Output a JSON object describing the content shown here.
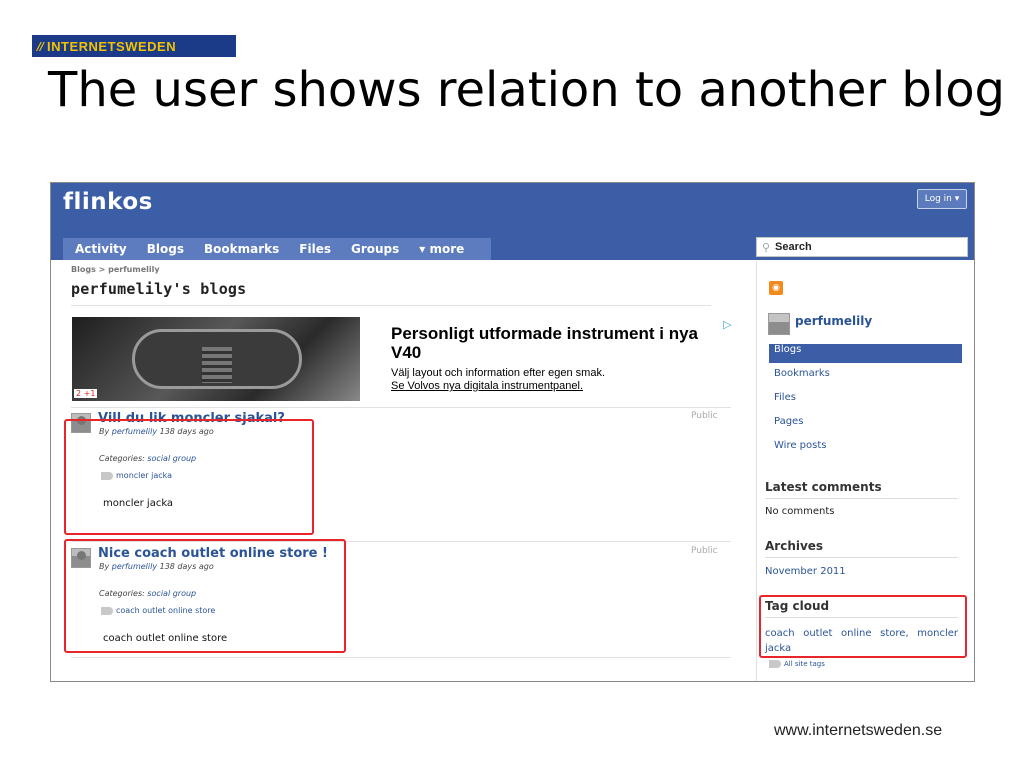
{
  "slide": {
    "logo_mark": "∕∕",
    "logo_text": "INTERNETSWEDEN",
    "title": "The user shows relation to another blog",
    "footer_url": "www.internetsweden.se"
  },
  "site": {
    "name": "flinkos",
    "login_label": "Log in ▾",
    "nav": [
      "Activity",
      "Blogs",
      "Bookmarks",
      "Files",
      "Groups",
      "▾ more"
    ],
    "search_label": "Search",
    "search_icon": "magnifier-icon"
  },
  "main": {
    "breadcrumb": "Blogs > perfumelily",
    "page_title": "perfumelily's blogs",
    "ad": {
      "badge": "2 +1",
      "title": "Personligt utformade instrument i nya V40",
      "line1": "Välj layout och information efter egen smak.",
      "line2": "Se Volvos nya digitala instrumentpanel.",
      "play_icon": "▷"
    },
    "posts": [
      {
        "title": "Vill du lik moncler sjakal?",
        "by_prefix": "By ",
        "author": "perfumelily",
        "age": " 138 days ago",
        "visibility": "Public",
        "categories_label": "Categories: ",
        "category": "social group",
        "tag": "moncler jacka",
        "body": "moncler jacka"
      },
      {
        "title": "Nice coach outlet online store !",
        "by_prefix": "By ",
        "author": "perfumelily",
        "age": " 138 days ago",
        "visibility": "Public",
        "categories_label": "Categories: ",
        "category": "social group",
        "tag": "coach outlet online store",
        "body": "coach outlet online store"
      }
    ]
  },
  "sidebar": {
    "rss_icon": "rss-icon",
    "user": "perfumelily",
    "menu": [
      "Blogs",
      "Bookmarks",
      "Files",
      "Pages",
      "Wire posts"
    ],
    "latest_comments_title": "Latest comments",
    "latest_comments_text": "No comments",
    "archives_title": "Archives",
    "archive_link": "November 2011",
    "tag_cloud_title": "Tag cloud",
    "tag_cloud_tags": "coach outlet online store, moncler jacka",
    "all_site_tags": "All site tags"
  },
  "colors": {
    "header_blue": "#3b5ea7",
    "link_blue": "#2b5496",
    "highlight_red": "#e8252a",
    "logo_navy": "#1b3a88",
    "logo_yellow": "#f2c200"
  }
}
